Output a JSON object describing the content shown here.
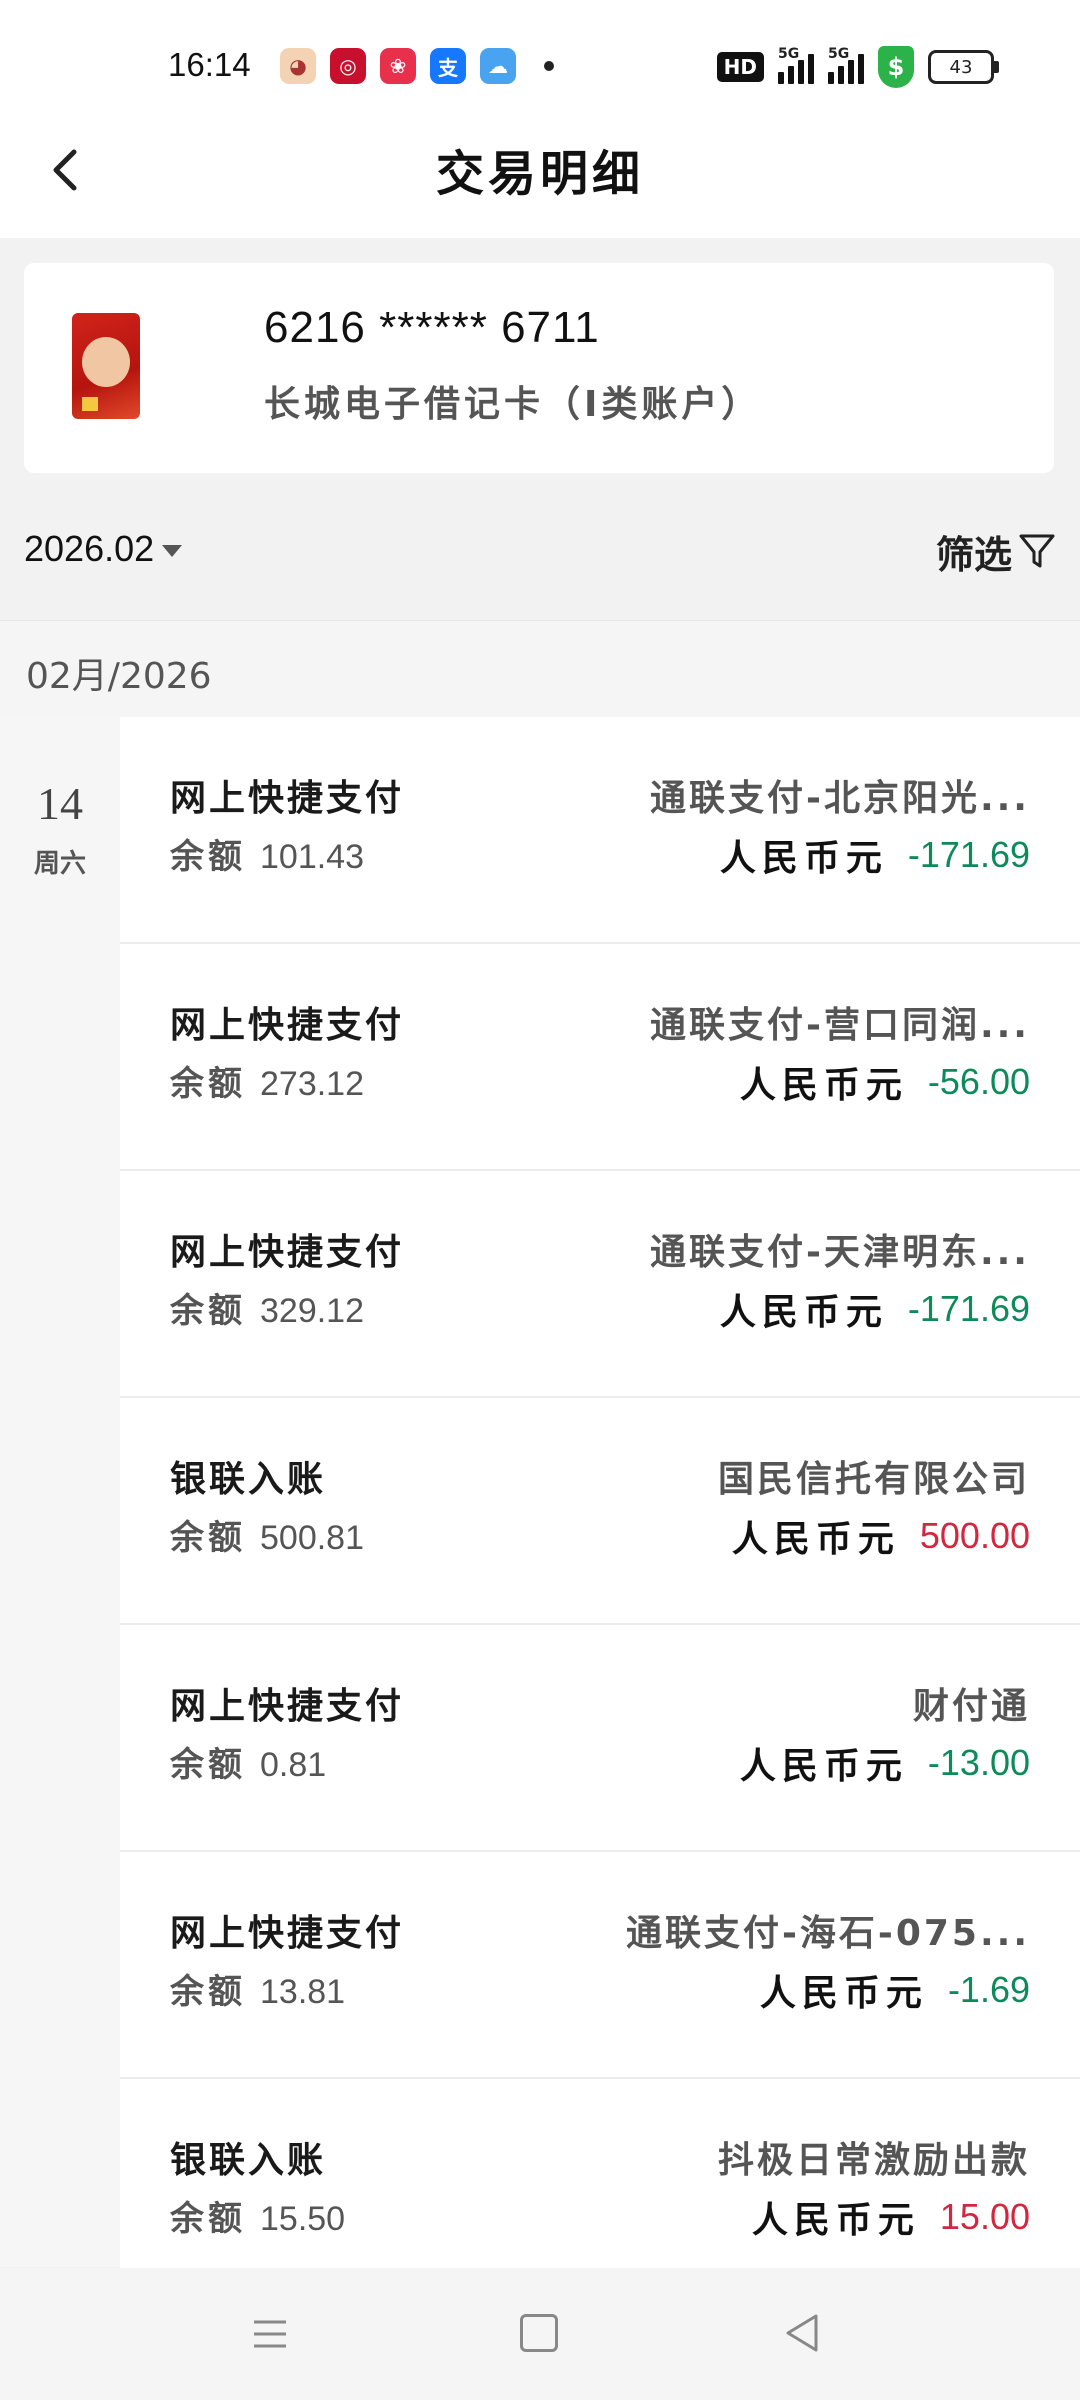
{
  "status": {
    "time": "16:14",
    "net_a": "5G",
    "net_b": "5G",
    "hd": "HD",
    "battery": "43"
  },
  "header": {
    "title": "交易明细"
  },
  "card": {
    "number": "6216 ****** 6711",
    "name": "长城电子借记卡（I类账户）"
  },
  "filter": {
    "month": "2026.02",
    "label": "筛选"
  },
  "month_header": "02月/2026",
  "date": {
    "day": "14",
    "weekday": "周六"
  },
  "transactions": [
    {
      "type": "网上快捷支付",
      "balance_label": "余额",
      "balance": "101.43",
      "merchant": "通联支付-北京阳光...",
      "currency": "人民币元",
      "amount": "-171.69"
    },
    {
      "type": "网上快捷支付",
      "balance_label": "余额",
      "balance": "273.12",
      "merchant": "通联支付-营口同润...",
      "currency": "人民币元",
      "amount": "-56.00"
    },
    {
      "type": "网上快捷支付",
      "balance_label": "余额",
      "balance": "329.12",
      "merchant": "通联支付-天津明东...",
      "currency": "人民币元",
      "amount": "-171.69"
    },
    {
      "type": "银联入账",
      "balance_label": "余额",
      "balance": "500.81",
      "merchant": "国民信托有限公司",
      "currency": "人民币元",
      "amount": "500.00"
    },
    {
      "type": "网上快捷支付",
      "balance_label": "余额",
      "balance": "0.81",
      "merchant": "财付通",
      "currency": "人民币元",
      "amount": "-13.00"
    },
    {
      "type": "网上快捷支付",
      "balance_label": "余额",
      "balance": "13.81",
      "merchant": "通联支付-海石-075...",
      "currency": "人民币元",
      "amount": "-1.69"
    },
    {
      "type": "银联入账",
      "balance_label": "余额",
      "balance": "15.50",
      "merchant": "抖极日常激励出款",
      "currency": "人民币元",
      "amount": "15.00"
    }
  ],
  "colors": {
    "debit": "#0c8a5a",
    "credit": "#d3263f"
  },
  "icons": [
    "back-arrow-icon",
    "filter-icon",
    "caret-down-icon",
    "menu-icon",
    "home-icon",
    "nav-back-icon"
  ]
}
